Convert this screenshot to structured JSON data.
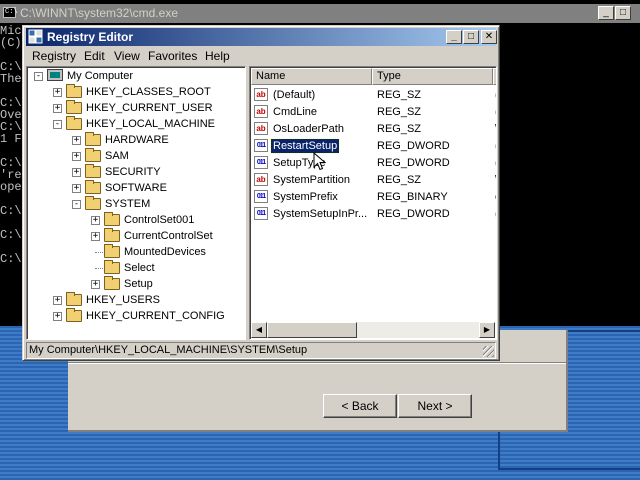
{
  "cmd": {
    "title": "C:\\WINNT\\system32\\cmd.exe",
    "icon": "C:\\",
    "lines": [
      "Mic",
      "(C)",
      "",
      "C:\\",
      "The",
      "",
      "C:\\",
      "Ove",
      "C:\\",
      "1 F",
      "",
      "C:\\",
      "'re",
      "ope",
      "",
      "C:\\",
      "",
      "C:\\",
      "",
      "C:\\"
    ],
    "controls": {
      "minimize": "_",
      "maximize": "□",
      "close": "✕"
    }
  },
  "regedit": {
    "title": "Registry Editor",
    "controls": {
      "minimize": "_",
      "maximize": "□",
      "close": "✕"
    },
    "menu": [
      "Registry",
      "Edit",
      "View",
      "Favorites",
      "Help"
    ],
    "tree": [
      {
        "label": "My Computer",
        "icon": "computer-icon",
        "expander": "-"
      },
      {
        "label": "HKEY_CLASSES_ROOT",
        "icon": "folder-icon",
        "expander": "+"
      },
      {
        "label": "HKEY_CURRENT_USER",
        "icon": "folder-icon",
        "expander": "+"
      },
      {
        "label": "HKEY_LOCAL_MACHINE",
        "icon": "folder-icon",
        "expander": "-"
      },
      {
        "label": "HARDWARE",
        "icon": "folder-icon",
        "expander": "+"
      },
      {
        "label": "SAM",
        "icon": "folder-icon",
        "expander": "+"
      },
      {
        "label": "SECURITY",
        "icon": "folder-icon",
        "expander": "+"
      },
      {
        "label": "SOFTWARE",
        "icon": "folder-icon",
        "expander": "+"
      },
      {
        "label": "SYSTEM",
        "icon": "folder-icon",
        "expander": "-"
      },
      {
        "label": "ControlSet001",
        "icon": "folder-icon",
        "expander": "+"
      },
      {
        "label": "CurrentControlSet",
        "icon": "folder-icon",
        "expander": "+"
      },
      {
        "label": "MountedDevices",
        "icon": "folder-icon",
        "expander": ""
      },
      {
        "label": "Select",
        "icon": "folder-icon",
        "expander": ""
      },
      {
        "label": "Setup",
        "icon": "open-folder-icon",
        "expander": "+"
      },
      {
        "label": "HKEY_USERS",
        "icon": "folder-icon",
        "expander": "+"
      },
      {
        "label": "HKEY_CURRENT_CONFIG",
        "icon": "folder-icon",
        "expander": "+"
      }
    ],
    "columns": [
      "Name",
      "Type",
      "D"
    ],
    "values": [
      {
        "name": "(Default)",
        "type": "REG_SZ",
        "data": "(",
        "icon": "ab"
      },
      {
        "name": "CmdLine",
        "type": "REG_SZ",
        "data": "(",
        "icon": "ab"
      },
      {
        "name": "OsLoaderPath",
        "type": "REG_SZ",
        "data": "\\",
        "icon": "ab"
      },
      {
        "name": "RestartSetup",
        "type": "REG_DWORD",
        "data": "(",
        "icon": "011",
        "selected": true
      },
      {
        "name": "SetupType",
        "type": "REG_DWORD",
        "data": "(",
        "icon": "011"
      },
      {
        "name": "SystemPartition",
        "type": "REG_SZ",
        "data": "\\",
        "icon": "ab"
      },
      {
        "name": "SystemPrefix",
        "type": "REG_BINARY",
        "data": "c",
        "icon": "011"
      },
      {
        "name": "SystemSetupInPr...",
        "type": "REG_DWORD",
        "data": "(",
        "icon": "011"
      }
    ],
    "scroll": {
      "left": "◀",
      "right": "▶"
    },
    "status": "My Computer\\HKEY_LOCAL_MACHINE\\SYSTEM\\Setup"
  },
  "wizard": {
    "back_label": "< Back",
    "next_label": "Next >"
  }
}
